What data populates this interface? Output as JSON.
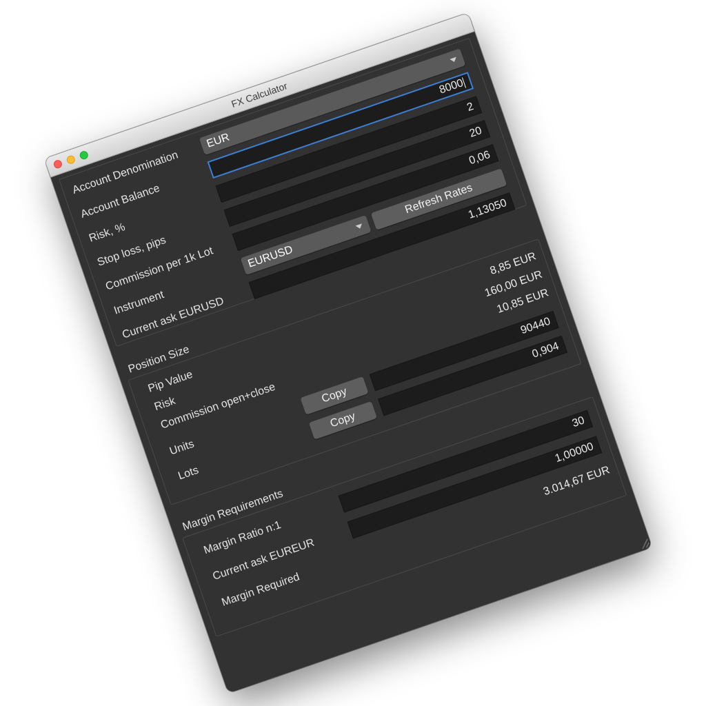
{
  "window": {
    "title": "FX Calculator"
  },
  "inputs": {
    "account_denomination_label": "Account Denomination",
    "account_denomination_value": "EUR",
    "account_balance_label": "Account Balance",
    "account_balance_value": "8000",
    "risk_label": "Risk, %",
    "risk_value": "2",
    "stop_loss_label": "Stop loss, pips",
    "stop_loss_value": "20",
    "commission_label": "Commission per 1k Lot",
    "commission_value": "0,06",
    "instrument_label": "Instrument",
    "instrument_value": "EURUSD",
    "refresh_label": "Refresh Rates",
    "current_ask_label": "Current ask EURUSD",
    "current_ask_value": "1,13050"
  },
  "position_size": {
    "title": "Position Size",
    "pip_value_label": "Pip Value",
    "pip_value_value": "8,85 EUR",
    "risk_label": "Risk",
    "risk_value": "160,00 EUR",
    "commission_label": "Commission open+close",
    "commission_value": "10,85 EUR",
    "units_label": "Units",
    "units_value": "90440",
    "lots_label": "Lots",
    "lots_value": "0,904",
    "copy_label": "Copy"
  },
  "margin": {
    "title": "Margin Requirements",
    "ratio_label": "Margin Ratio n:1",
    "ratio_value": "30",
    "ask_label": "Current ask EUREUR",
    "ask_value": "1,00000",
    "required_label": "Margin Required",
    "required_value": "3.014,67 EUR"
  }
}
